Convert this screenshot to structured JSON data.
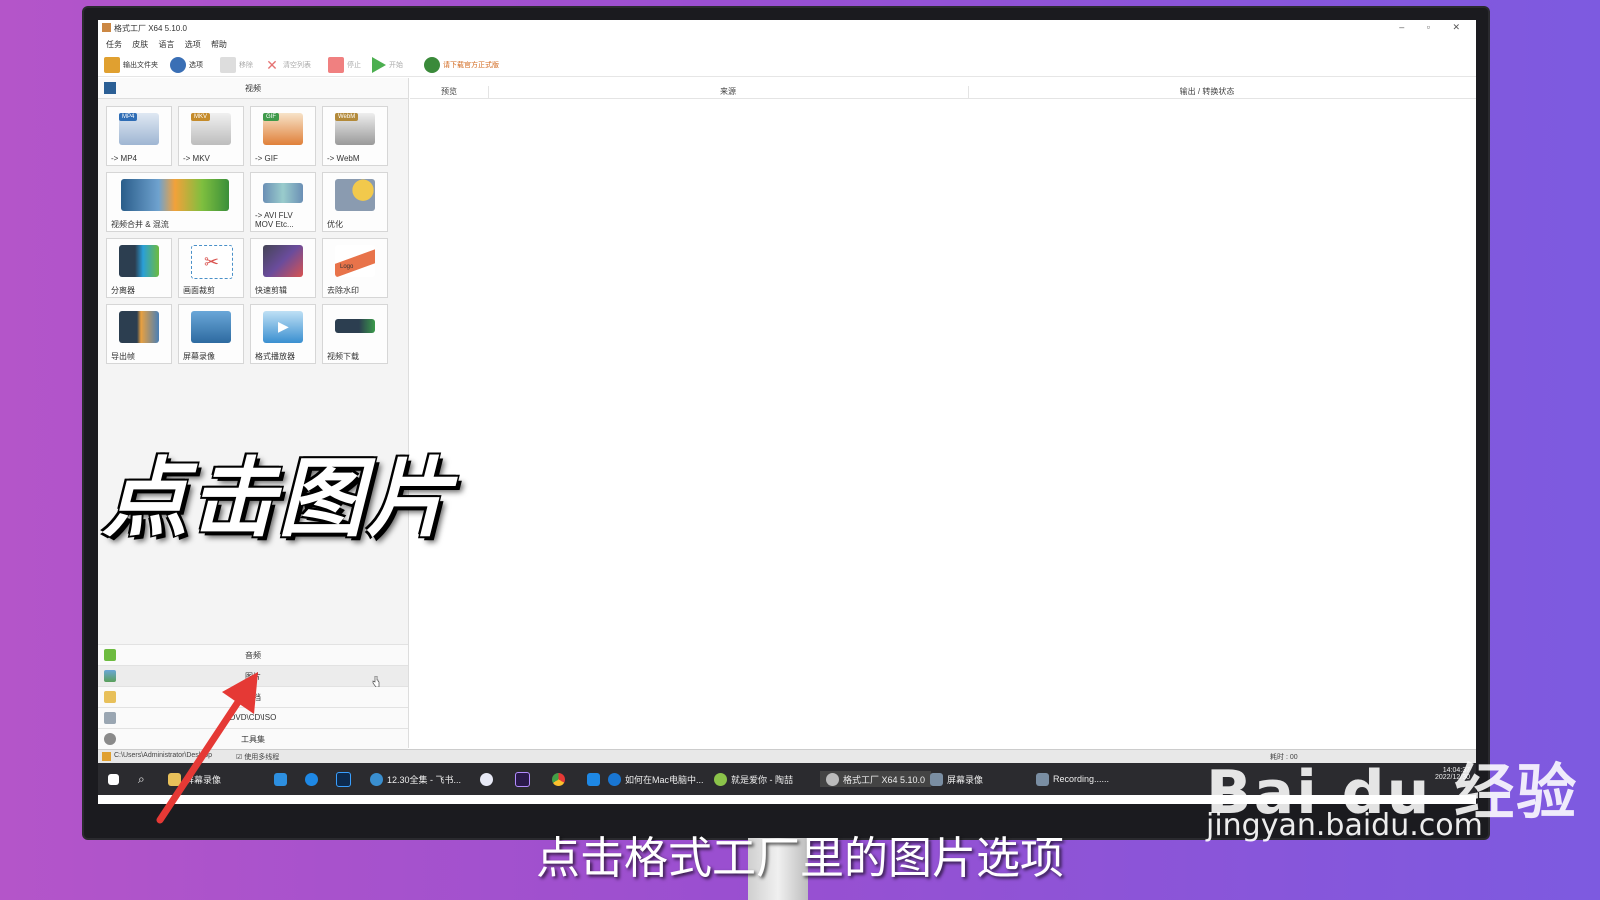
{
  "window": {
    "title": "格式工厂 X64 5.10.0",
    "controls": [
      "–",
      "▫",
      "✕"
    ]
  },
  "menu": [
    "任务",
    "皮肤",
    "语言",
    "选项",
    "帮助"
  ],
  "toolbar": {
    "output_folder": "输出文件夹",
    "options": "选项",
    "remove": "移除",
    "clear_list": "清空列表",
    "stop": "停止",
    "start": "开始",
    "promo": "请下载官方正式版"
  },
  "sidebar": {
    "video_header": "视频",
    "tiles": [
      {
        "label": "-> MP4",
        "badge": "MP4"
      },
      {
        "label": "-> MKV",
        "badge": "MKV"
      },
      {
        "label": "-> GIF",
        "badge": "GIF"
      },
      {
        "label": "-> WebM",
        "badge": "WebM"
      },
      {
        "label": "视频合并 & 混流",
        "badge": ""
      },
      {
        "label": "-> AVI FLV\nMOV Etc...",
        "badge": ""
      },
      {
        "label": "优化",
        "badge": ""
      },
      {
        "label": "分离器",
        "badge": ""
      },
      {
        "label": "画面裁剪",
        "badge": ""
      },
      {
        "label": "快速剪辑",
        "badge": ""
      },
      {
        "label": "去除水印",
        "badge": "Logo"
      },
      {
        "label": "导出帧",
        "badge": ""
      },
      {
        "label": "屏幕录像",
        "badge": ""
      },
      {
        "label": "格式播放器",
        "badge": ""
      },
      {
        "label": "视频下载",
        "badge": ""
      }
    ],
    "categories": [
      "音频",
      "图片",
      "文档",
      "DVD\\CD\\ISO",
      "工具集"
    ],
    "selected_category": "图片"
  },
  "task_list": {
    "columns": [
      "预览",
      "来源",
      "输出 / 转换状态"
    ]
  },
  "statusbar": {
    "path": "C:\\Users\\Administrator\\Desktop",
    "multithread": "使用多线程",
    "elapsed": "耗时 : 00"
  },
  "taskbar": {
    "items": [
      "屏幕录像",
      "12.30全集 - 飞书...",
      "如何在Mac电脑中...",
      "就是爱你 - 陶喆",
      "格式工厂 X64 5.10.0",
      "屏幕录像",
      "Recording......"
    ],
    "clock": "14:04:37",
    "date": "2022/12/30"
  },
  "overlay": {
    "caption": "点击图片",
    "subtitle": "点击格式工厂里的图片选项"
  },
  "watermark": {
    "logo": "Bai du 经验",
    "url": "jingyan.baidu.com"
  },
  "colors": {
    "accent_arrow": "#e53935",
    "background_left": "#b455c9",
    "background_right": "#7d5ae0"
  }
}
